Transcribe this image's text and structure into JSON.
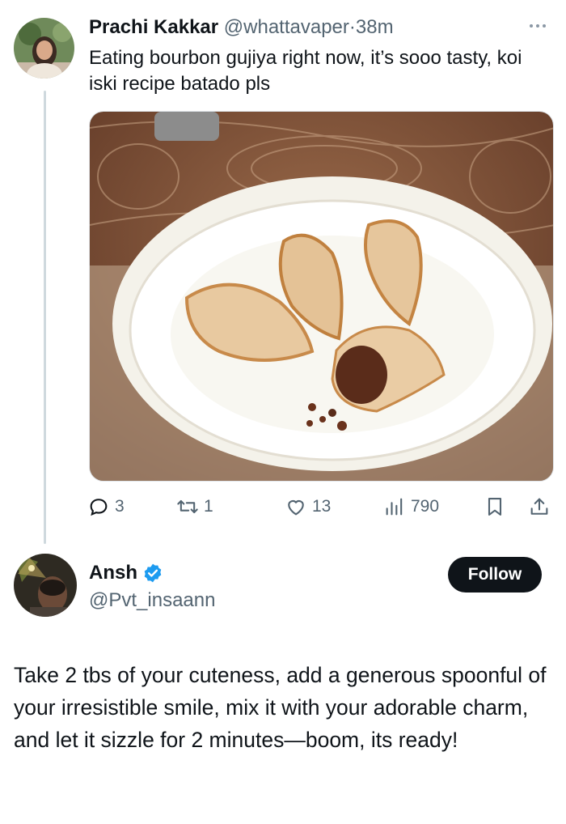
{
  "tweet1": {
    "name": "Prachi Kakkar",
    "handle": "@whattavaper",
    "separator": "·",
    "time": "38m",
    "text": "Eating bourbon gujiya right now, it’s sooo tasty, koi iski recipe batado pls",
    "stats": {
      "replies": "3",
      "retweets": "1",
      "likes": "13",
      "views": "790"
    }
  },
  "tweet2": {
    "name": "Ansh",
    "handle": "@Pvt_insaann",
    "follow_label": "Follow",
    "text": "Take 2 tbs of your cuteness, add a generous spoonful of your irresistible smile, mix it with your adorable charm, and let it sizzle for 2 minutes—boom, its ready!"
  },
  "colors": {
    "text_primary": "#0f1419",
    "text_secondary": "#536471",
    "verified_blue": "#1d9bf0",
    "follow_bg": "#0f1419"
  },
  "icons": [
    "more-icon",
    "reply-icon",
    "retweet-icon",
    "like-icon",
    "views-icon",
    "bookmark-icon",
    "share-icon",
    "verified-icon"
  ]
}
